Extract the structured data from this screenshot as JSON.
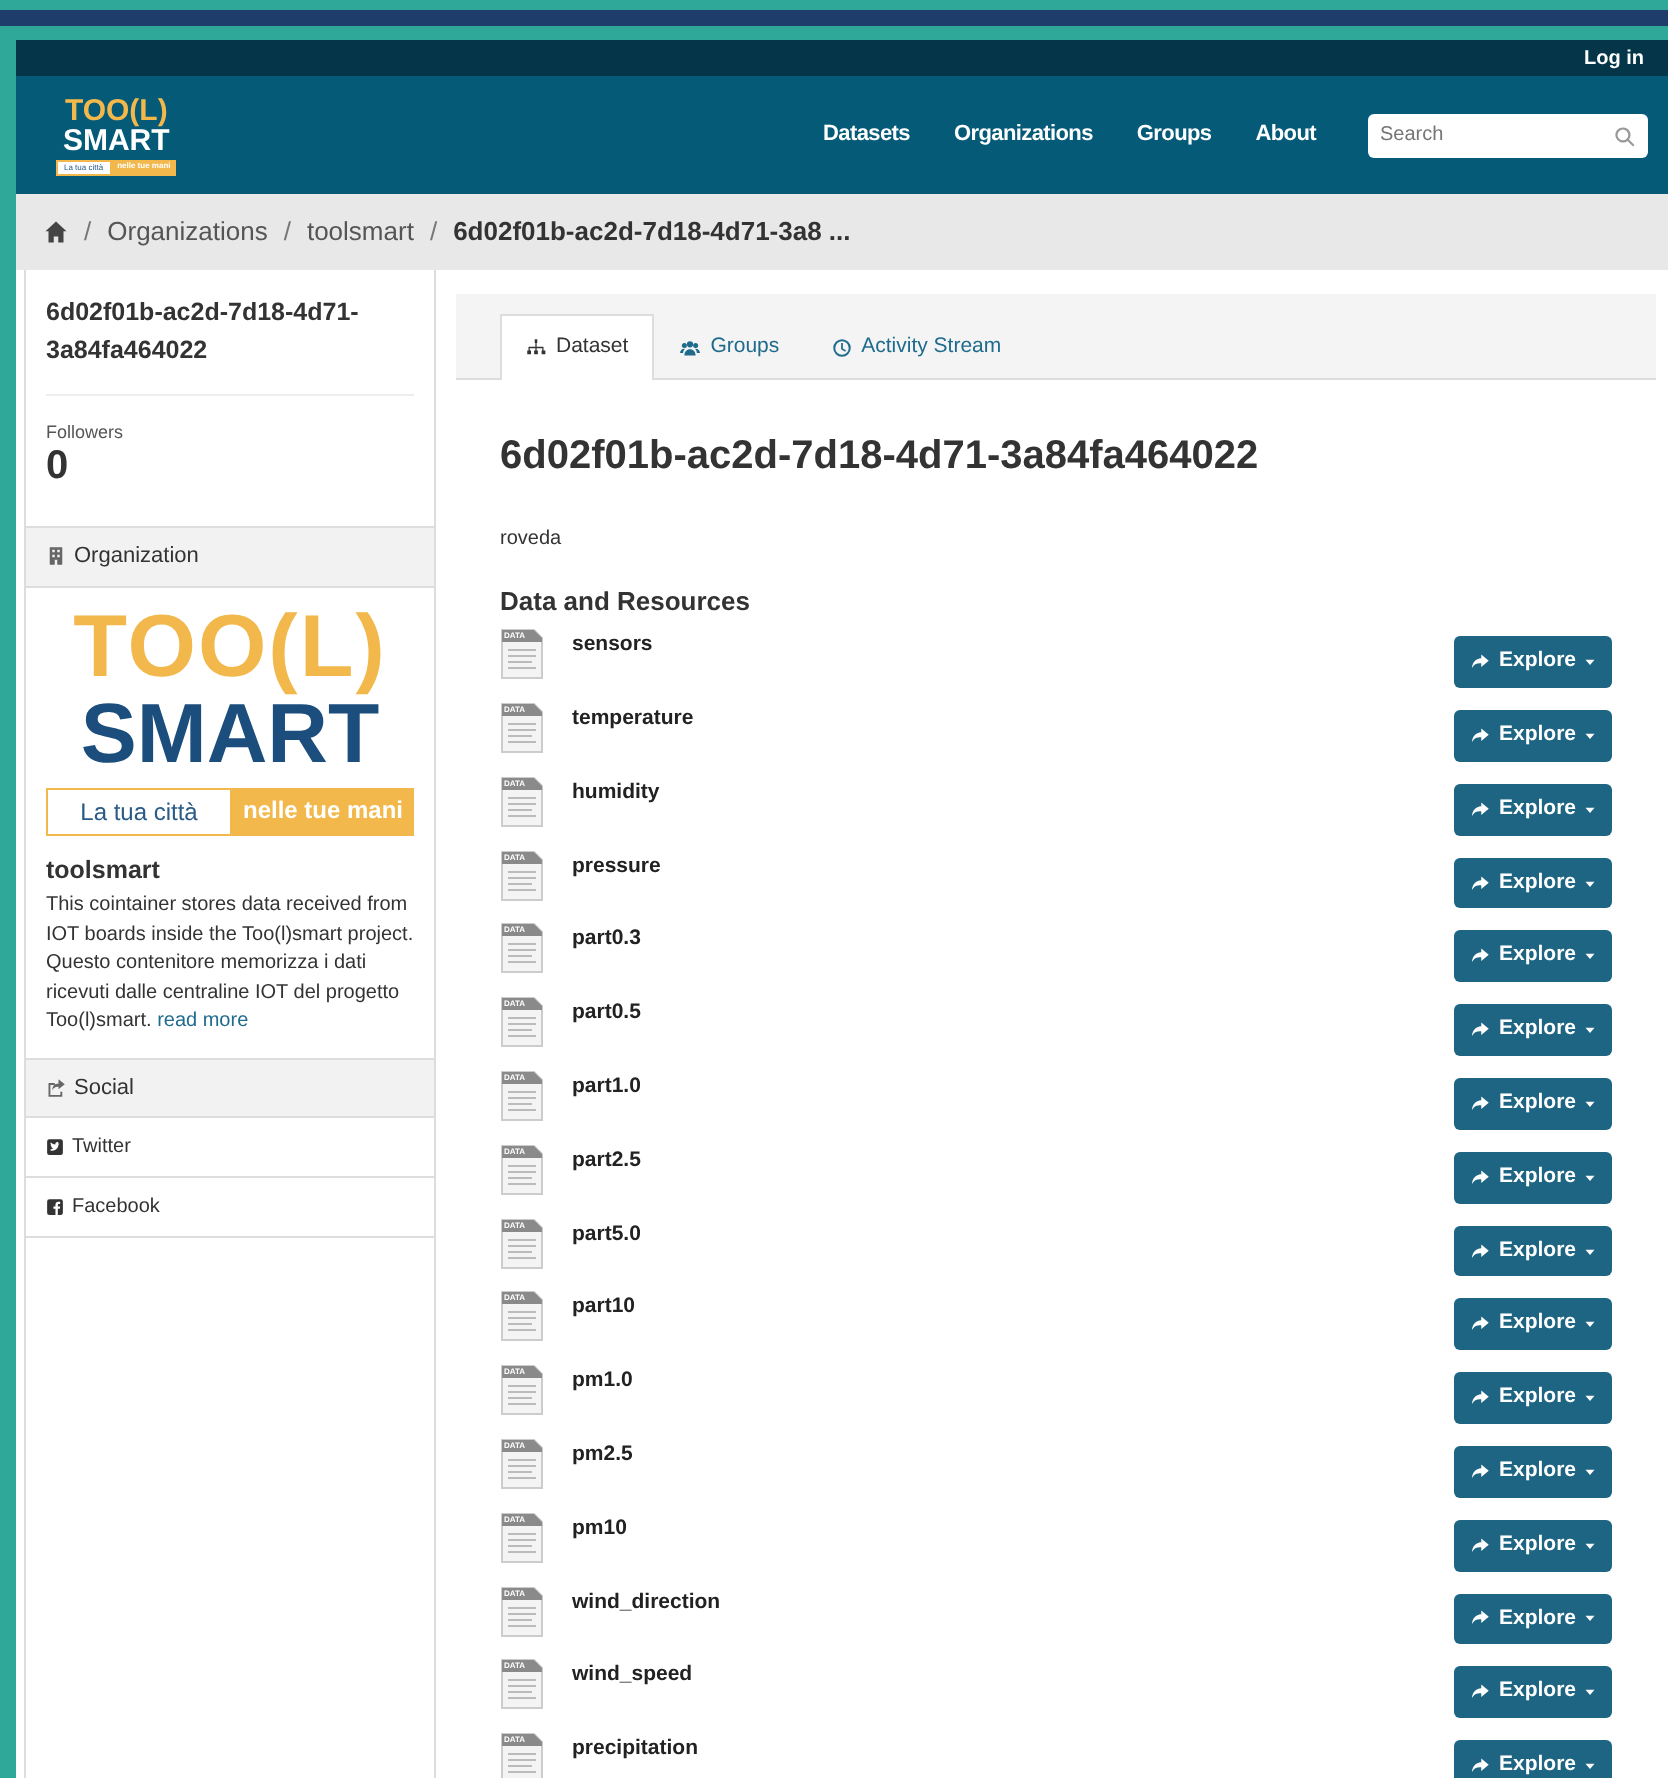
{
  "topbar": {
    "login": "Log in"
  },
  "header": {
    "logo": {
      "line1": "TOO(L)",
      "line2": "SMART",
      "tagline_left": "La tua città",
      "tagline_right": "nelle tue mani"
    },
    "nav": [
      "Datasets",
      "Organizations",
      "Groups",
      "About"
    ],
    "search": {
      "placeholder": "Search"
    }
  },
  "breadcrumb": [
    "Organizations",
    "toolsmart",
    "6d02f01b-ac2d-7d18-4d71-3a8 ..."
  ],
  "breadcrumb_separators": [
    "/",
    "/",
    "/"
  ],
  "sidebar": {
    "title": "6d02f01b-ac2d-7d18-4d71-3a84fa464022",
    "followers_label": "Followers",
    "followers": "0",
    "organization_heading": "Organization",
    "org_logo": {
      "line1": "TOO(L)",
      "line2": "SMART",
      "tagline_left": "La tua città",
      "tagline_right": "nelle tue mani"
    },
    "org_name": "toolsmart",
    "org_description": "This cointainer stores data received from IOT boards inside the Too(l)smart project. Questo contenitore memorizza i dati ricevuti dalle centraline IOT del progetto Too(l)smart.",
    "read_more": "read more",
    "social_heading": "Social",
    "social": [
      {
        "kind": "twitter",
        "label": "Twitter"
      },
      {
        "kind": "facebook",
        "label": "Facebook"
      }
    ]
  },
  "tabs": [
    {
      "kind": "dataset",
      "label": "Dataset",
      "selected": true
    },
    {
      "kind": "groups",
      "label": "Groups",
      "selected": false
    },
    {
      "kind": "activity",
      "label": "Activity Stream",
      "selected": false
    }
  ],
  "dataset": {
    "title": "6d02f01b-ac2d-7d18-4d71-3a84fa464022",
    "author": "roveda",
    "resources_heading": "Data and Resources",
    "resources": [
      {
        "name": "sensors",
        "format": "DATA",
        "button": "Explore"
      },
      {
        "name": "temperature",
        "format": "DATA",
        "button": "Explore"
      },
      {
        "name": "humidity",
        "format": "DATA",
        "button": "Explore"
      },
      {
        "name": "pressure",
        "format": "DATA",
        "button": "Explore"
      },
      {
        "name": "part0.3",
        "format": "DATA",
        "button": "Explore"
      },
      {
        "name": "part0.5",
        "format": "DATA",
        "button": "Explore"
      },
      {
        "name": "part1.0",
        "format": "DATA",
        "button": "Explore"
      },
      {
        "name": "part2.5",
        "format": "DATA",
        "button": "Explore"
      },
      {
        "name": "part5.0",
        "format": "DATA",
        "button": "Explore"
      },
      {
        "name": "part10",
        "format": "DATA",
        "button": "Explore"
      },
      {
        "name": "pm1.0",
        "format": "DATA",
        "button": "Explore"
      },
      {
        "name": "pm2.5",
        "format": "DATA",
        "button": "Explore"
      },
      {
        "name": "pm10",
        "format": "DATA",
        "button": "Explore"
      },
      {
        "name": "wind_direction",
        "format": "DATA",
        "button": "Explore"
      },
      {
        "name": "wind_speed",
        "format": "DATA",
        "button": "Explore"
      },
      {
        "name": "precipitation",
        "format": "DATA",
        "button": "Explore"
      }
    ]
  }
}
